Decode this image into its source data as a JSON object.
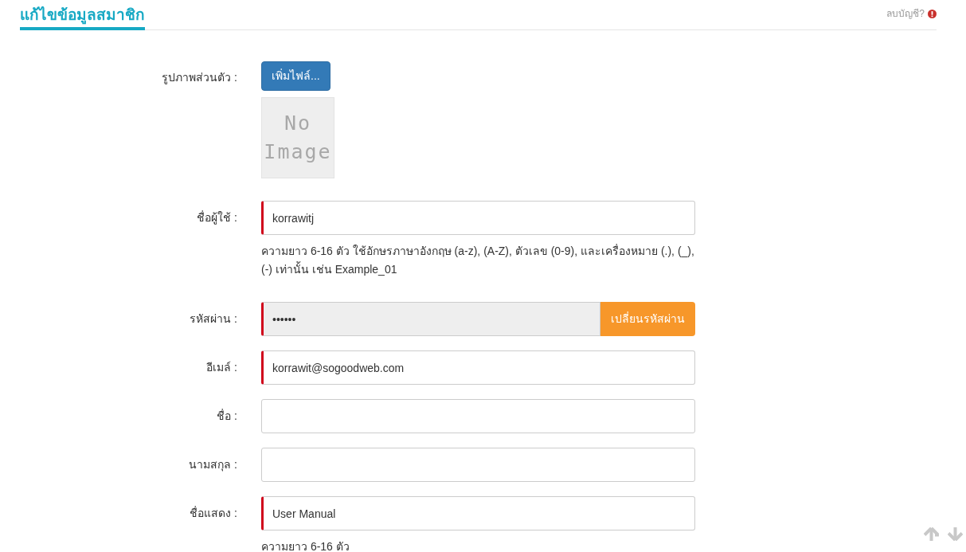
{
  "header": {
    "title": "แก้ไขข้อมูลสมาชิก",
    "delete_link": "ลบบัญชี?"
  },
  "avatar": {
    "label": "รูปภาพส่วนตัว :",
    "button": "เพิ่มไฟล์...",
    "image_text": [
      "No",
      "Image"
    ]
  },
  "fields": [
    {
      "label": "ชื่อผู้ใช้ :",
      "value": "korrawitj",
      "required": true,
      "disabled": false,
      "help": "ความยาว 6-16 ตัว ใช้อักษรภาษาอังกฤษ (a-z), (A-Z), ตัวเลข (0-9), และเครื่องหมาย (.), (_), (-) เท่านั้น เช่น Example_01"
    },
    {
      "label": "รหัสผ่าน :",
      "value": "••••••",
      "required": true,
      "disabled": true,
      "button": "เปลี่ยนรหัสผ่าน"
    },
    {
      "label": "อีเมล์ :",
      "value": "korrawit@sogoodweb.com",
      "required": true,
      "disabled": false
    },
    {
      "label": "ชื่อ :",
      "required": false,
      "disabled": false
    },
    {
      "label": "นามสกุล :",
      "required": false,
      "disabled": false
    },
    {
      "label": "ชื่อแสดง :",
      "value": "User Manual",
      "required": true,
      "disabled": false,
      "help": "ความยาว 6-16 ตัว"
    }
  ]
}
